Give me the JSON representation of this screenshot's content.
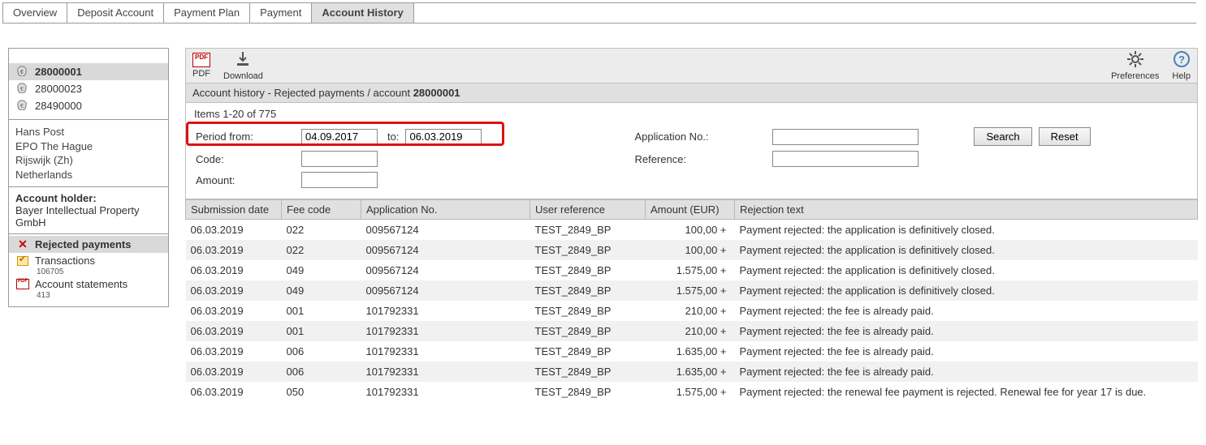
{
  "tabs": [
    "Overview",
    "Deposit Account",
    "Payment Plan",
    "Payment",
    "Account History"
  ],
  "active_tab": 4,
  "toolbar": {
    "pdf": "PDF",
    "download": "Download",
    "preferences": "Preferences",
    "help": "Help"
  },
  "accounts": [
    {
      "number": "28000001",
      "selected": true
    },
    {
      "number": "28000023",
      "selected": false
    },
    {
      "number": "28490000",
      "selected": false
    }
  ],
  "address": [
    "Hans Post",
    "EPO The Hague",
    "Rijswijk (Zh)",
    "Netherlands"
  ],
  "holder": {
    "label": "Account holder:",
    "name": "Bayer Intellectual Property GmbH"
  },
  "sidenav": {
    "rejected": {
      "label": "Rejected payments",
      "selected": true
    },
    "transactions": {
      "label": "Transactions",
      "count": "106705"
    },
    "statements": {
      "label": "Account statements",
      "count": "413"
    }
  },
  "title": {
    "prefix": "Account history - Rejected payments / account ",
    "acct": "28000001"
  },
  "items_text": "Items 1-20 of 775",
  "filter": {
    "period_from_label": "Period from:",
    "period_from": "04.09.2017",
    "to_label": "to:",
    "period_to": "06.03.2019",
    "app_label": "Application No.:",
    "app_val": "",
    "code_label": "Code:",
    "code_val": "",
    "ref_label": "Reference:",
    "ref_val": "",
    "amount_label": "Amount:",
    "amount_val": "",
    "search": "Search",
    "reset": "Reset"
  },
  "grid": {
    "headers": [
      "Submission date",
      "Fee code",
      "Application No.",
      "User reference",
      "Amount (EUR)",
      "Rejection text"
    ],
    "rows": [
      [
        "06.03.2019",
        "022",
        "009567124",
        "TEST_2849_BP",
        "100,00 +",
        "Payment rejected: the application is definitively closed."
      ],
      [
        "06.03.2019",
        "022",
        "009567124",
        "TEST_2849_BP",
        "100,00 +",
        "Payment rejected: the application is definitively closed."
      ],
      [
        "06.03.2019",
        "049",
        "009567124",
        "TEST_2849_BP",
        "1.575,00 +",
        "Payment rejected: the application is definitively closed."
      ],
      [
        "06.03.2019",
        "049",
        "009567124",
        "TEST_2849_BP",
        "1.575,00 +",
        "Payment rejected: the application is definitively closed."
      ],
      [
        "06.03.2019",
        "001",
        "101792331",
        "TEST_2849_BP",
        "210,00 +",
        "Payment rejected: the fee is already paid."
      ],
      [
        "06.03.2019",
        "001",
        "101792331",
        "TEST_2849_BP",
        "210,00 +",
        "Payment rejected: the fee is already paid."
      ],
      [
        "06.03.2019",
        "006",
        "101792331",
        "TEST_2849_BP",
        "1.635,00 +",
        "Payment rejected: the fee is already paid."
      ],
      [
        "06.03.2019",
        "006",
        "101792331",
        "TEST_2849_BP",
        "1.635,00 +",
        "Payment rejected: the fee is already paid."
      ],
      [
        "06.03.2019",
        "050",
        "101792331",
        "TEST_2849_BP",
        "1.575,00 +",
        "Payment rejected: the renewal fee payment is rejected. Renewal fee for year 17 is due."
      ]
    ]
  }
}
